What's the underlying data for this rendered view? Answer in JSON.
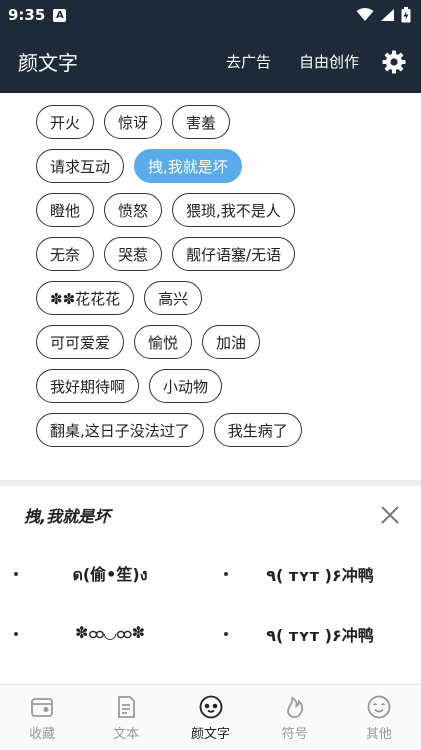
{
  "status_bar": {
    "time": "9:35",
    "notif_letter": "A"
  },
  "app_bar": {
    "title": "颜文字",
    "actions": [
      "去广告",
      "自由创作"
    ]
  },
  "chip_rows": [
    [
      {
        "label": "开火"
      },
      {
        "label": "惊讶"
      },
      {
        "label": "害羞"
      }
    ],
    [
      {
        "label": "请求互动"
      },
      {
        "label": "拽,我就是坏",
        "active": true
      }
    ],
    [
      {
        "label": "瞪他"
      },
      {
        "label": "愤怒"
      },
      {
        "label": "猥琐,我不是人"
      }
    ],
    [
      {
        "label": "无奈"
      },
      {
        "label": "哭惹"
      },
      {
        "label": "靓仔语塞/无语"
      }
    ],
    [
      {
        "label": "✽✽花花花"
      },
      {
        "label": "高兴"
      }
    ],
    [
      {
        "label": "可可爱爱"
      },
      {
        "label": "愉悦"
      },
      {
        "label": "加油"
      }
    ],
    [
      {
        "label": "我好期待啊"
      },
      {
        "label": "小动物"
      }
    ],
    [
      {
        "label": "翻桌,这日子没法过了"
      },
      {
        "label": "我生病了"
      }
    ]
  ],
  "panel": {
    "title": "拽,我就是坏",
    "items": [
      "ด(偷•笙)ง",
      "٩( ᴛʏᴛ )۶冲鸭",
      "✽ထ◡ထ✽",
      "٩( ᴛʏᴛ )۶冲鸭"
    ]
  },
  "nav": [
    {
      "label": "收藏",
      "icon": "wallet-icon"
    },
    {
      "label": "文本",
      "icon": "document-icon"
    },
    {
      "label": "颜文字",
      "icon": "emoticon-face-icon",
      "active": true
    },
    {
      "label": "符号",
      "icon": "flame-icon"
    },
    {
      "label": "其他",
      "icon": "smile-face-icon"
    }
  ]
}
